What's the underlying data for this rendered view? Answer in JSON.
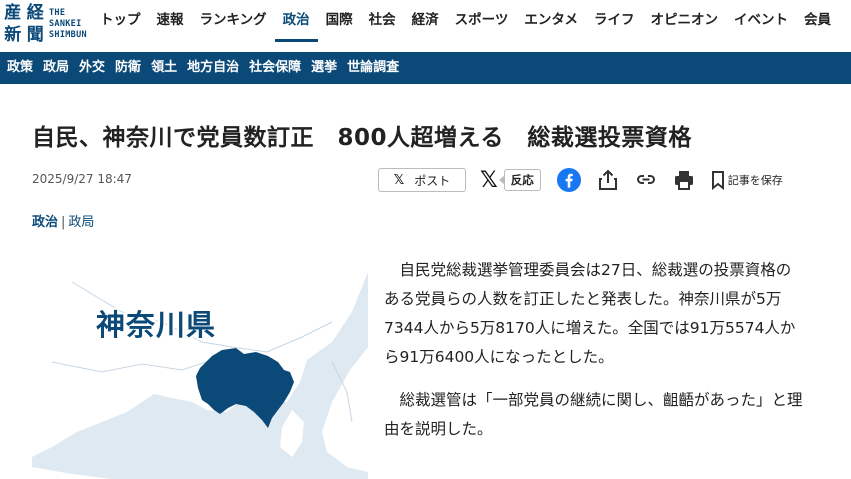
{
  "logo": {
    "kanji": [
      "産",
      "経",
      "新",
      "聞"
    ],
    "text_lines": [
      "THE",
      "SANKEI",
      "SHIMBUN"
    ]
  },
  "nav": {
    "items": [
      {
        "label": "トップ"
      },
      {
        "label": "速報"
      },
      {
        "label": "ランキング"
      },
      {
        "label": "政治",
        "active": true
      },
      {
        "label": "国際"
      },
      {
        "label": "社会"
      },
      {
        "label": "経済"
      },
      {
        "label": "スポーツ"
      },
      {
        "label": "エンタメ"
      },
      {
        "label": "ライフ"
      },
      {
        "label": "オピニオン"
      },
      {
        "label": "イベント"
      },
      {
        "label": "会員"
      }
    ]
  },
  "subnav": {
    "items": [
      "政策",
      "政局",
      "外交",
      "防衛",
      "領土",
      "地方自治",
      "社会保障",
      "選挙",
      "世論調査"
    ]
  },
  "article": {
    "headline": "自民、神奈川で党員数訂正　800人超増える　総裁選投票資格",
    "date": "2025/9/27 18:47",
    "category_main": "政治",
    "category_sep": "|",
    "category_sub": "政局",
    "paragraphs": [
      "自民党総裁選挙管理委員会は27日、総裁選の投票資格のある党員らの人数を訂正したと発表した。神奈川県が5万7344人から5万8170人に増えた。全国では91万5574人から91万6400人になったとした。",
      "総裁選管は「一部党員の継続に関し、齟齬があった」と理由を説明した。"
    ]
  },
  "share": {
    "post_x": "𝕏",
    "post_label": "ポスト",
    "x_big": "𝕏",
    "react_label": "反応",
    "save_label": "記事を保存"
  },
  "map": {
    "label": "神奈川県",
    "sea_color": "#dfe9f2",
    "land_color": "#ffffff",
    "highlight_color": "#0b4a78"
  },
  "colors": {
    "brand": "#0b4a78",
    "facebook": "#1877f2"
  },
  "icons": [
    "x-logo-icon",
    "facebook-icon",
    "share-icon",
    "link-icon",
    "print-icon",
    "bookmark-icon"
  ]
}
